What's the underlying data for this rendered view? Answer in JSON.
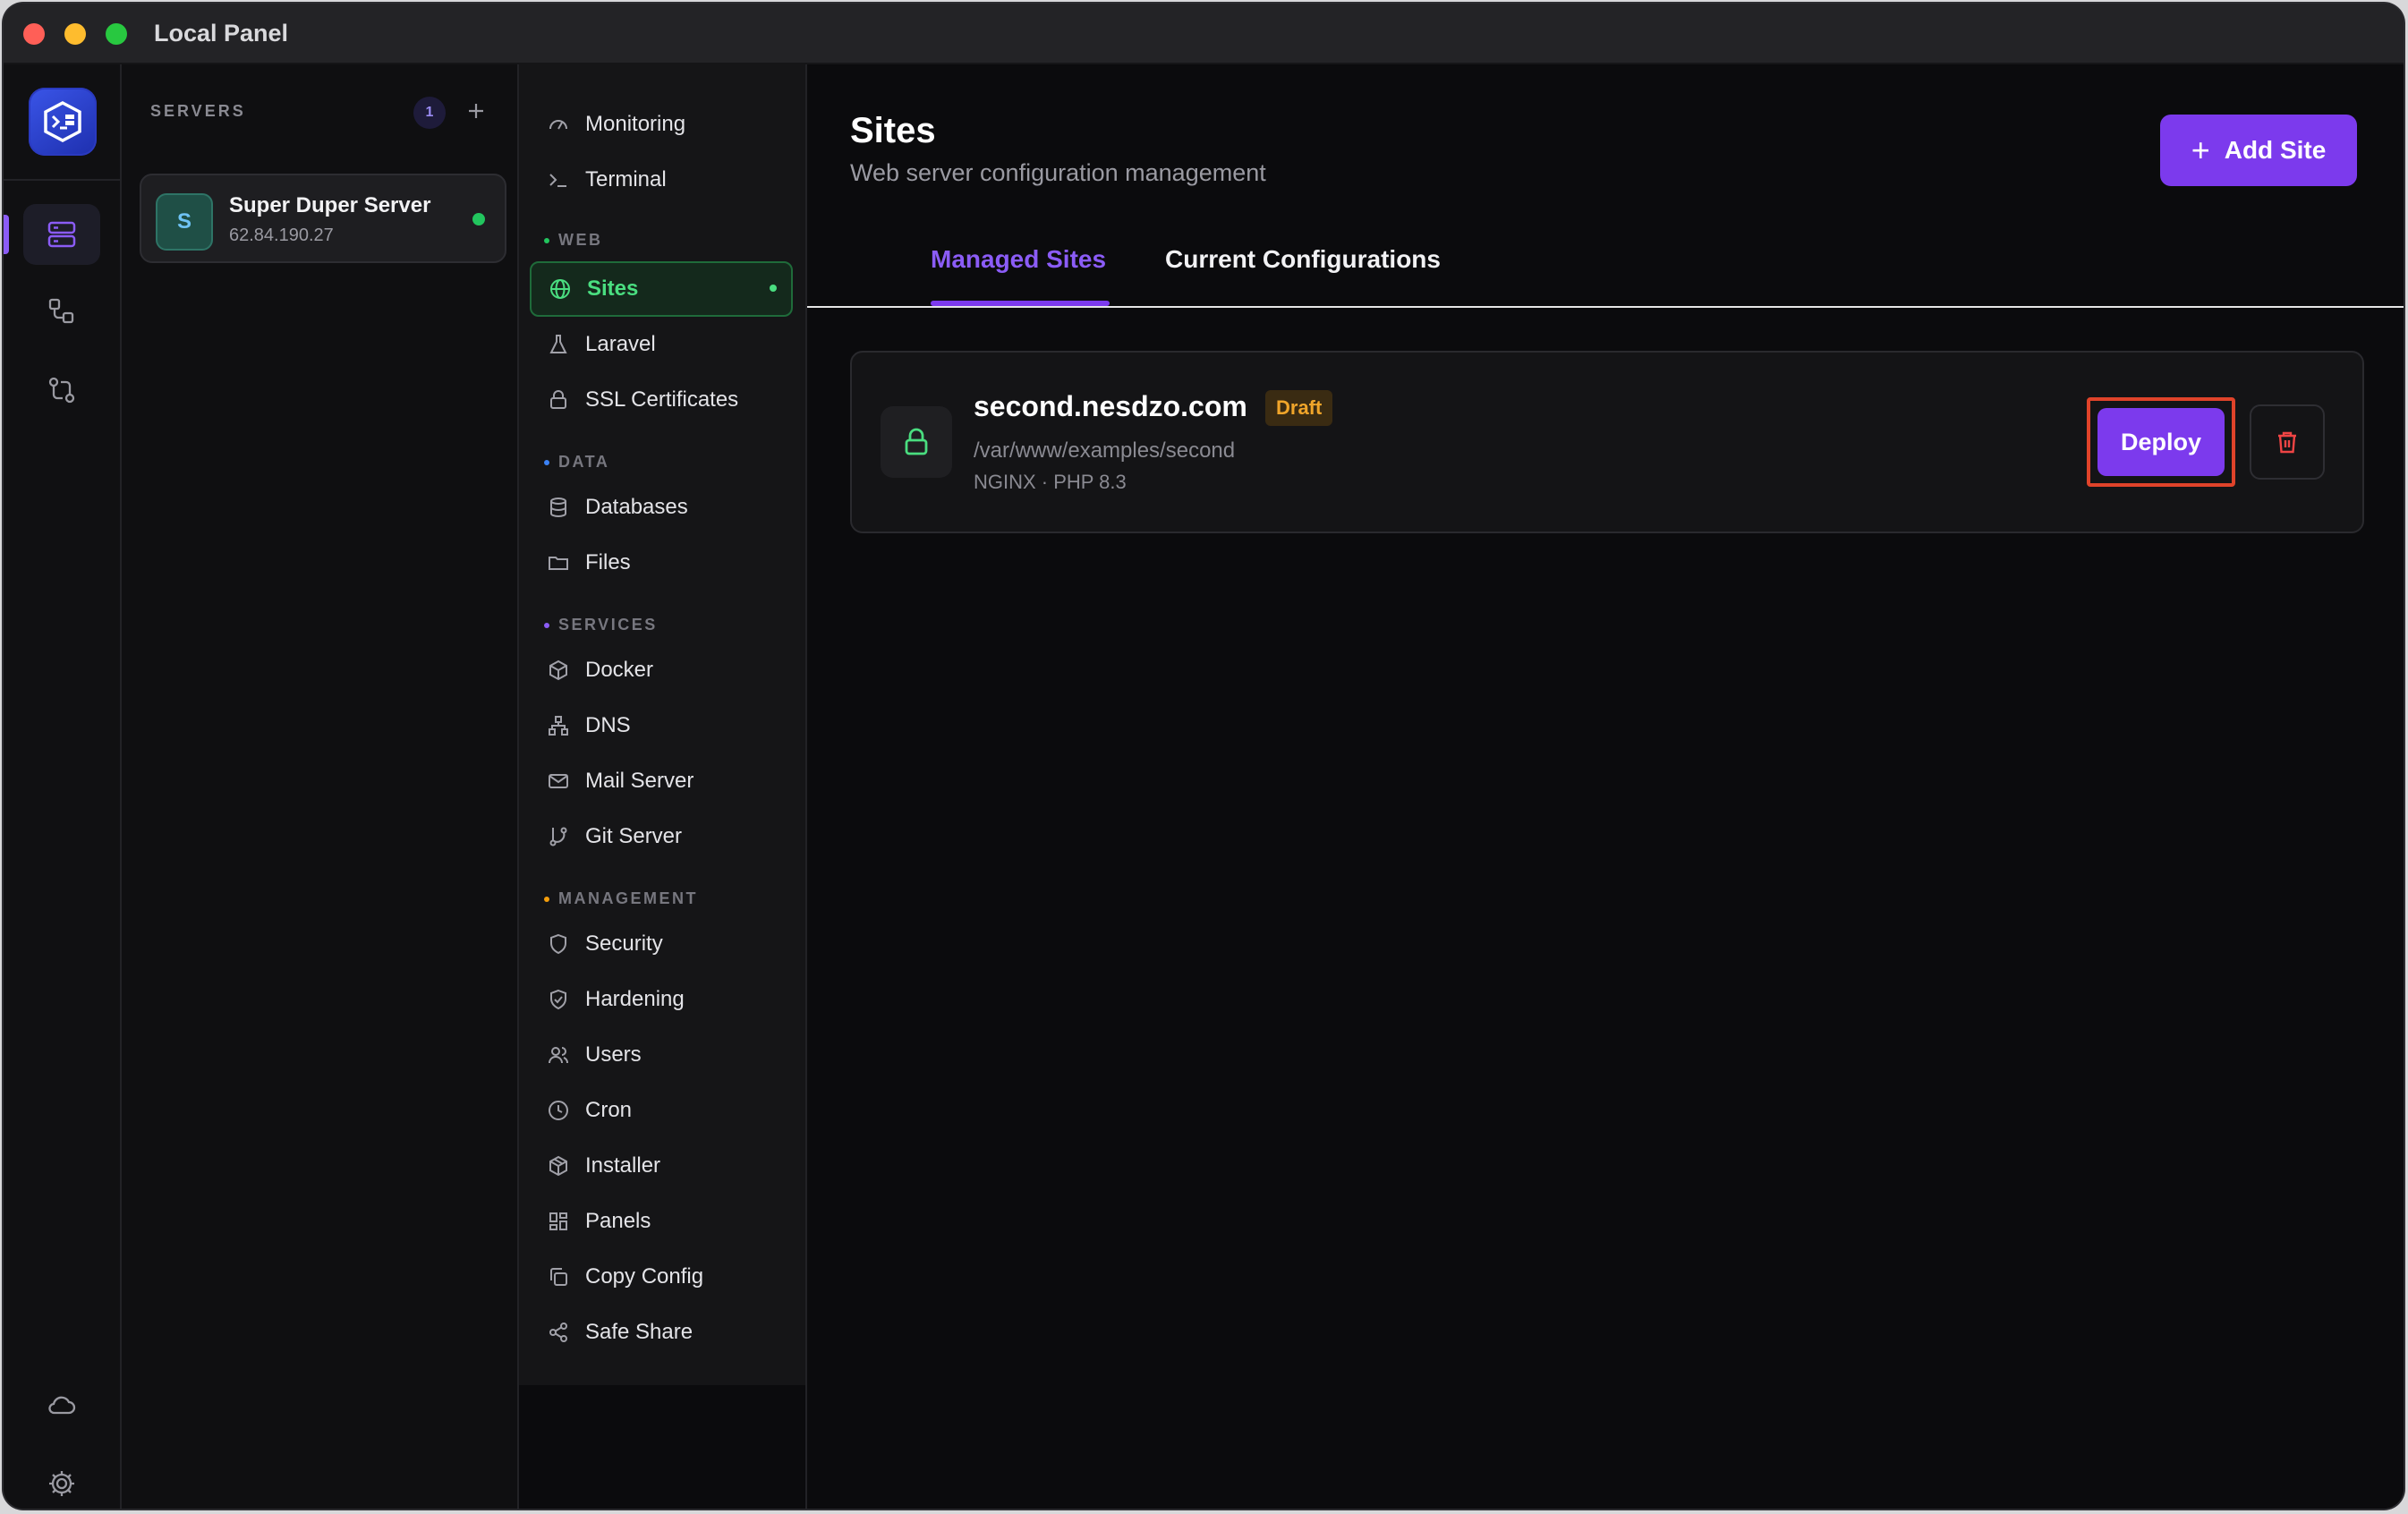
{
  "window": {
    "title": "Local Panel"
  },
  "servers": {
    "heading": "SERVERS",
    "count": "1",
    "items": [
      {
        "initial": "S",
        "name": "Super Duper Server",
        "ip": "62.84.190.27"
      }
    ]
  },
  "nav": {
    "top": [
      {
        "label": "Monitoring",
        "icon": "gauge-icon"
      },
      {
        "label": "Terminal",
        "icon": "terminal-icon"
      }
    ],
    "sections": [
      {
        "title": "WEB",
        "color": "#22c55e"
      },
      {
        "title": "DATA",
        "color": "#3b82f6"
      },
      {
        "title": "SERVICES",
        "color": "#8b5cf6"
      },
      {
        "title": "MANAGEMENT",
        "color": "#f59e0b"
      }
    ],
    "web": [
      {
        "label": "Sites",
        "icon": "globe-icon"
      },
      {
        "label": "Laravel",
        "icon": "flask-icon"
      },
      {
        "label": "SSL Certificates",
        "icon": "lock-icon"
      }
    ],
    "data": [
      {
        "label": "Databases",
        "icon": "database-icon"
      },
      {
        "label": "Files",
        "icon": "folder-icon"
      }
    ],
    "services": [
      {
        "label": "Docker",
        "icon": "box-icon"
      },
      {
        "label": "DNS",
        "icon": "network-icon"
      },
      {
        "label": "Mail Server",
        "icon": "mail-icon"
      },
      {
        "label": "Git Server",
        "icon": "git-branch-icon"
      }
    ],
    "management": [
      {
        "label": "Security",
        "icon": "shield-icon"
      },
      {
        "label": "Hardening",
        "icon": "shield-check-icon"
      },
      {
        "label": "Users",
        "icon": "users-icon"
      },
      {
        "label": "Cron",
        "icon": "clock-icon"
      },
      {
        "label": "Installer",
        "icon": "package-icon"
      },
      {
        "label": "Panels",
        "icon": "grid-icon"
      },
      {
        "label": "Copy Config",
        "icon": "copy-icon"
      },
      {
        "label": "Safe Share",
        "icon": "share-icon"
      }
    ]
  },
  "main": {
    "title": "Sites",
    "subtitle": "Web server configuration management",
    "add_button": "Add Site",
    "tabs": [
      {
        "label": "Managed Sites",
        "active": true
      },
      {
        "label": "Current Configurations",
        "active": false
      }
    ],
    "sites": [
      {
        "domain": "second.nesdzo.com",
        "status": "Draft",
        "path": "/var/www/examples/second",
        "meta": "NGINX · PHP 8.3",
        "deploy_label": "Deploy"
      }
    ]
  },
  "colors": {
    "accent": "#7c3aed",
    "active_green": "#4ade80",
    "draft": "#f0a52a",
    "danger": "#ef4444"
  }
}
